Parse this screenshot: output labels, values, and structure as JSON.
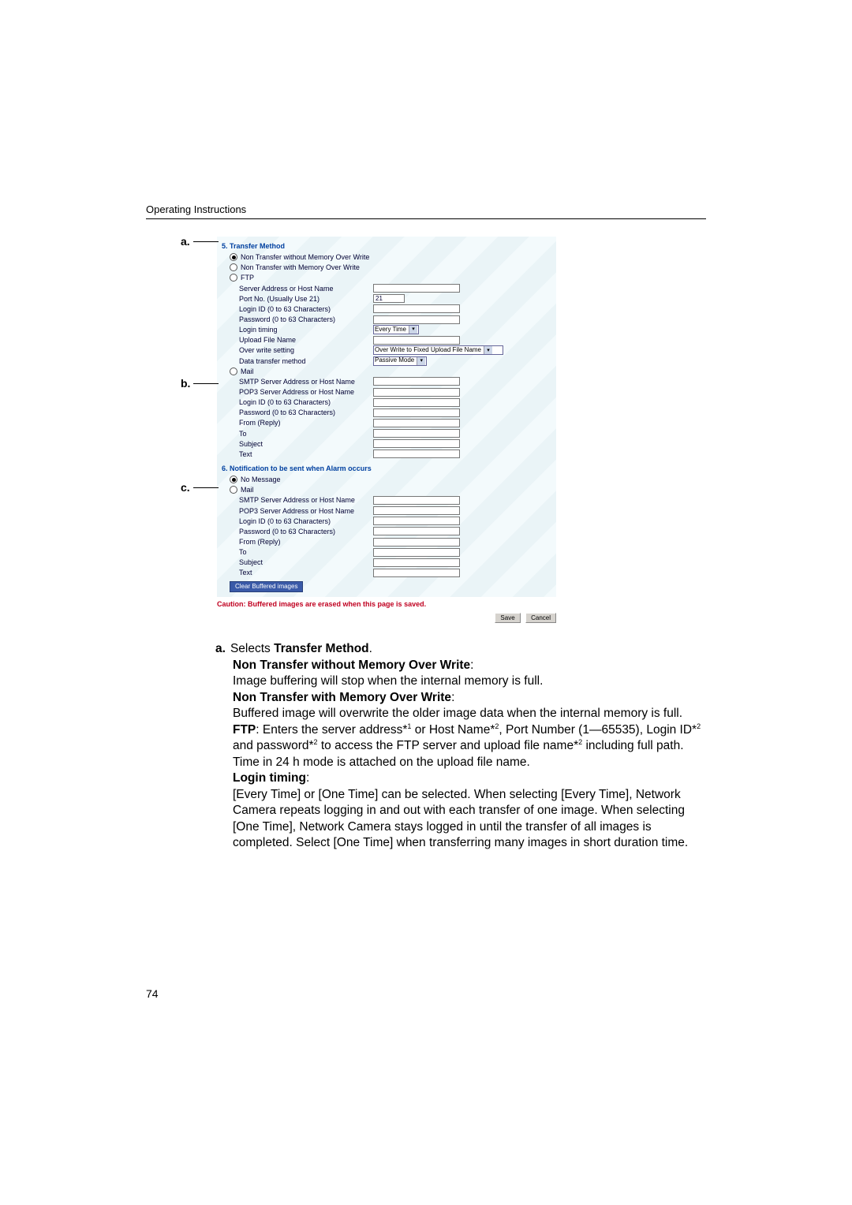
{
  "header": "Operating Instructions",
  "page_number": "74",
  "annot": {
    "a": "a.",
    "b": "b.",
    "c": "c."
  },
  "shot": {
    "section5": {
      "num_title": "5.  Transfer Method",
      "opt_non_without": "Non Transfer without Memory Over Write",
      "opt_non_with": "Non Transfer with Memory Over Write",
      "opt_ftp": "FTP",
      "ftp": {
        "server": "Server Address or Host Name",
        "port": "Port No. (Usually Use 21)",
        "port_value": "21",
        "login": "Login ID (0 to 63 Characters)",
        "password": "Password (0 to 63 Characters)",
        "login_timing": "Login timing",
        "login_timing_value": "Every Time",
        "upload_file": "Upload File Name",
        "overwrite": "Over write setting",
        "overwrite_value": "Over Write to Fixed Upload File Name",
        "transfer_method": "Data transfer method",
        "transfer_method_value": "Passive Mode"
      },
      "opt_mail": "Mail",
      "mail": {
        "smtp": "SMTP Server Address or Host Name",
        "pop3": "POP3 Server Address or Host Name",
        "login": "Login ID (0 to 63 Characters)",
        "password": "Password (0 to 63 Characters)",
        "from": "From (Reply)",
        "to": "To",
        "subject": "Subject",
        "text": "Text"
      }
    },
    "section6": {
      "num_title": "6.  Notification to be sent when Alarm occurs",
      "opt_no_message": "No Message",
      "opt_mail": "Mail",
      "mail": {
        "smtp": "SMTP Server Address or Host Name",
        "pop3": "POP3 Server Address or Host Name",
        "login": "Login ID (0 to 63 Characters)",
        "password": "Password (0 to 63 Characters)",
        "from": "From (Reply)",
        "to": "To",
        "subject": "Subject",
        "text": "Text"
      },
      "clear_button": "Clear Buffered images"
    },
    "caution": "Caution: Buffered images are erased when this page is saved.",
    "save": "Save",
    "cancel": "Cancel"
  },
  "expl": {
    "a_letter": "a.",
    "a_lead": "Selects ",
    "a_bold1": "Transfer Method",
    "a_bold2": "Non Transfer without Memory Over Write",
    "a_text2": "Image buffering will stop when the internal memory is full.",
    "a_bold3": "Non Transfer with Memory Over Write",
    "a_text3": "Buffered image will overwrite the older image data when the internal memory is full.",
    "a_ftp_bold": "FTP",
    "a_ftp_text1": ": Enters the server address*",
    "a_ftp_sup1": "1",
    "a_ftp_text2": " or Host Name*",
    "a_ftp_sup2": "2",
    "a_ftp_text3": ", Port Number (1—65535), Login ID*",
    "a_ftp_sup3": "2",
    "a_ftp_text4": " and password*",
    "a_ftp_sup4": "2",
    "a_ftp_text5": " to access the FTP server and upload file name*",
    "a_ftp_sup5": "2",
    "a_ftp_text6": " including full path. Time in 24 h mode is attached on the upload file name.",
    "login_bold": "Login timing",
    "login_text": "[Every Time] or [One Time] can be selected. When selecting [Every Time], Network Camera repeats logging in and out with each transfer of one image. When selecting [One Time], Network Camera stays logged in until the transfer of all images is completed. Select [One Time] when transferring many images in short duration time."
  }
}
